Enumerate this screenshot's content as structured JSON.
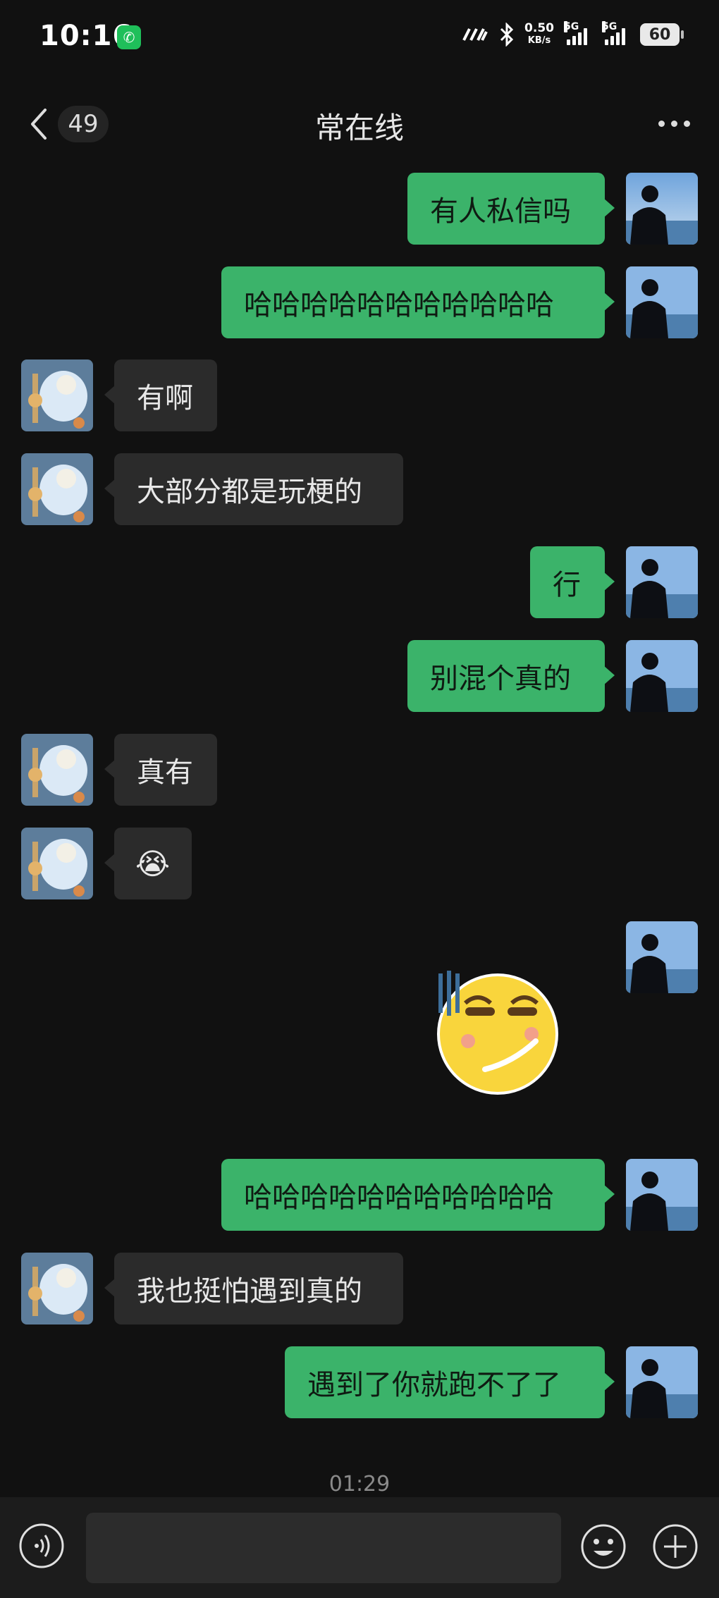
{
  "status_bar": {
    "time": "10:16",
    "net_speed_value": "0.50",
    "net_speed_unit": "KB/s",
    "signal1_label": "5G",
    "signal2_label": "5G",
    "battery": "60"
  },
  "header": {
    "back_label": "<",
    "unread_count": "49",
    "title": "常在线",
    "more_label": "more-options"
  },
  "messages": [
    {
      "sender": "me",
      "text": "有人私信吗"
    },
    {
      "sender": "me",
      "text": "哈哈哈哈哈哈哈哈哈哈哈"
    },
    {
      "sender": "them",
      "text": "有啊"
    },
    {
      "sender": "them",
      "text": "大部分都是玩梗的"
    },
    {
      "sender": "me",
      "text": "行"
    },
    {
      "sender": "me",
      "text": "别混个真的"
    },
    {
      "sender": "them",
      "text": "真有"
    },
    {
      "sender": "them",
      "text": "😭"
    },
    {
      "sender": "me",
      "sticker": "smirk-sweat-sticker"
    },
    {
      "sender": "me",
      "text": "哈哈哈哈哈哈哈哈哈哈哈"
    },
    {
      "sender": "them",
      "text": "我也挺怕遇到真的"
    },
    {
      "sender": "me",
      "text": "遇到了你就跑不了了"
    }
  ],
  "timestamp": "01:29",
  "input_bar": {
    "placeholder": "",
    "voice_icon": "voice-icon",
    "emoji_icon": "emoji-icon",
    "plus_icon": "plus-icon"
  },
  "colors": {
    "background": "#111111",
    "my_bubble": "#3bb36a",
    "their_bubble": "#2b2b2b",
    "accent_green": "#1fbf5a"
  }
}
